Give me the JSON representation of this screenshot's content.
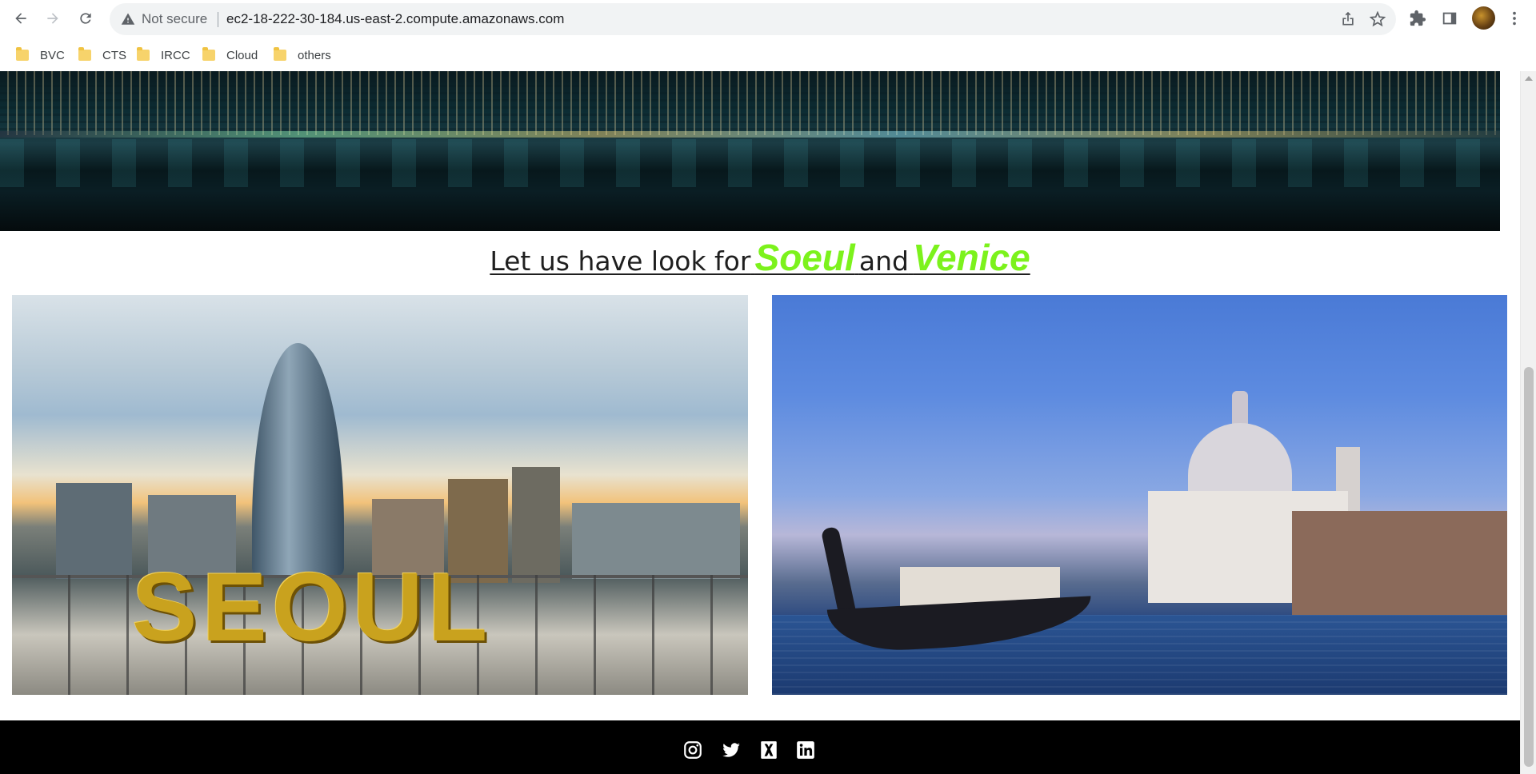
{
  "browser": {
    "security_label": "Not secure",
    "url": "ec2-18-222-30-184.us-east-2.compute.amazonaws.com",
    "icons": {
      "back": "back-arrow-icon",
      "forward": "forward-arrow-icon",
      "reload": "reload-icon",
      "warning": "warning-icon",
      "share": "share-icon",
      "bookmark": "star-icon",
      "extensions": "puzzle-icon",
      "side_panel": "side-panel-icon",
      "menu": "kebab-menu-icon"
    },
    "bookmarks": [
      {
        "label": "BVC"
      },
      {
        "label": "CTS"
      },
      {
        "label": "IRCC"
      },
      {
        "label": "Cloud"
      },
      {
        "label": "others"
      }
    ]
  },
  "page": {
    "heading": {
      "prefix": "Let us have look for",
      "city1": "Soeul",
      "connector": "and",
      "city2": "Venice"
    },
    "photos": [
      {
        "name": "seoul",
        "sign_text": "SEOUL"
      },
      {
        "name": "venice"
      }
    ],
    "footer": {
      "social": [
        {
          "icon": "instagram-icon"
        },
        {
          "icon": "twitter-icon"
        },
        {
          "icon": "x-icon"
        },
        {
          "icon": "linkedin-icon"
        }
      ]
    }
  },
  "colors": {
    "accent_city": "#7cf21c",
    "footer_bg": "#000000"
  }
}
